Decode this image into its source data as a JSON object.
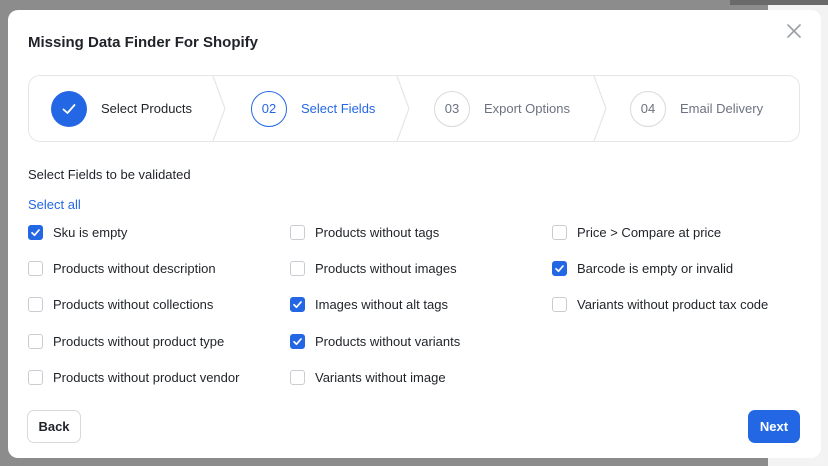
{
  "modal": {
    "title": "Missing Data Finder For Shopify",
    "close_icon": "close-icon"
  },
  "steps": [
    {
      "number": "",
      "label": "Select Products",
      "state": "done"
    },
    {
      "number": "02",
      "label": "Select Fields",
      "state": "active"
    },
    {
      "number": "03",
      "label": "Export Options",
      "state": "todo"
    },
    {
      "number": "04",
      "label": "Email Delivery",
      "state": "todo"
    }
  ],
  "section": {
    "title": "Select Fields to be validated",
    "select_all": "Select all"
  },
  "fields": [
    {
      "label": "Sku is empty",
      "checked": true
    },
    {
      "label": "Products without description",
      "checked": false
    },
    {
      "label": "Products without collections",
      "checked": false
    },
    {
      "label": "Products without product type",
      "checked": false
    },
    {
      "label": "Products without product vendor",
      "checked": false
    },
    {
      "label": "Products without tags",
      "checked": false
    },
    {
      "label": "Products without images",
      "checked": false
    },
    {
      "label": "Images without alt tags",
      "checked": true
    },
    {
      "label": "Products without variants",
      "checked": true
    },
    {
      "label": "Variants without image",
      "checked": false
    },
    {
      "label": "Price > Compare at price",
      "checked": false
    },
    {
      "label": "Barcode is empty or invalid",
      "checked": true
    },
    {
      "label": "Variants without product tax code",
      "checked": false
    }
  ],
  "footer": {
    "back_label": "Back",
    "next_label": "Next"
  },
  "colors": {
    "accent": "#2467e4",
    "border": "#e4e6ea",
    "text": "#1f2328",
    "muted": "#6b7280"
  }
}
